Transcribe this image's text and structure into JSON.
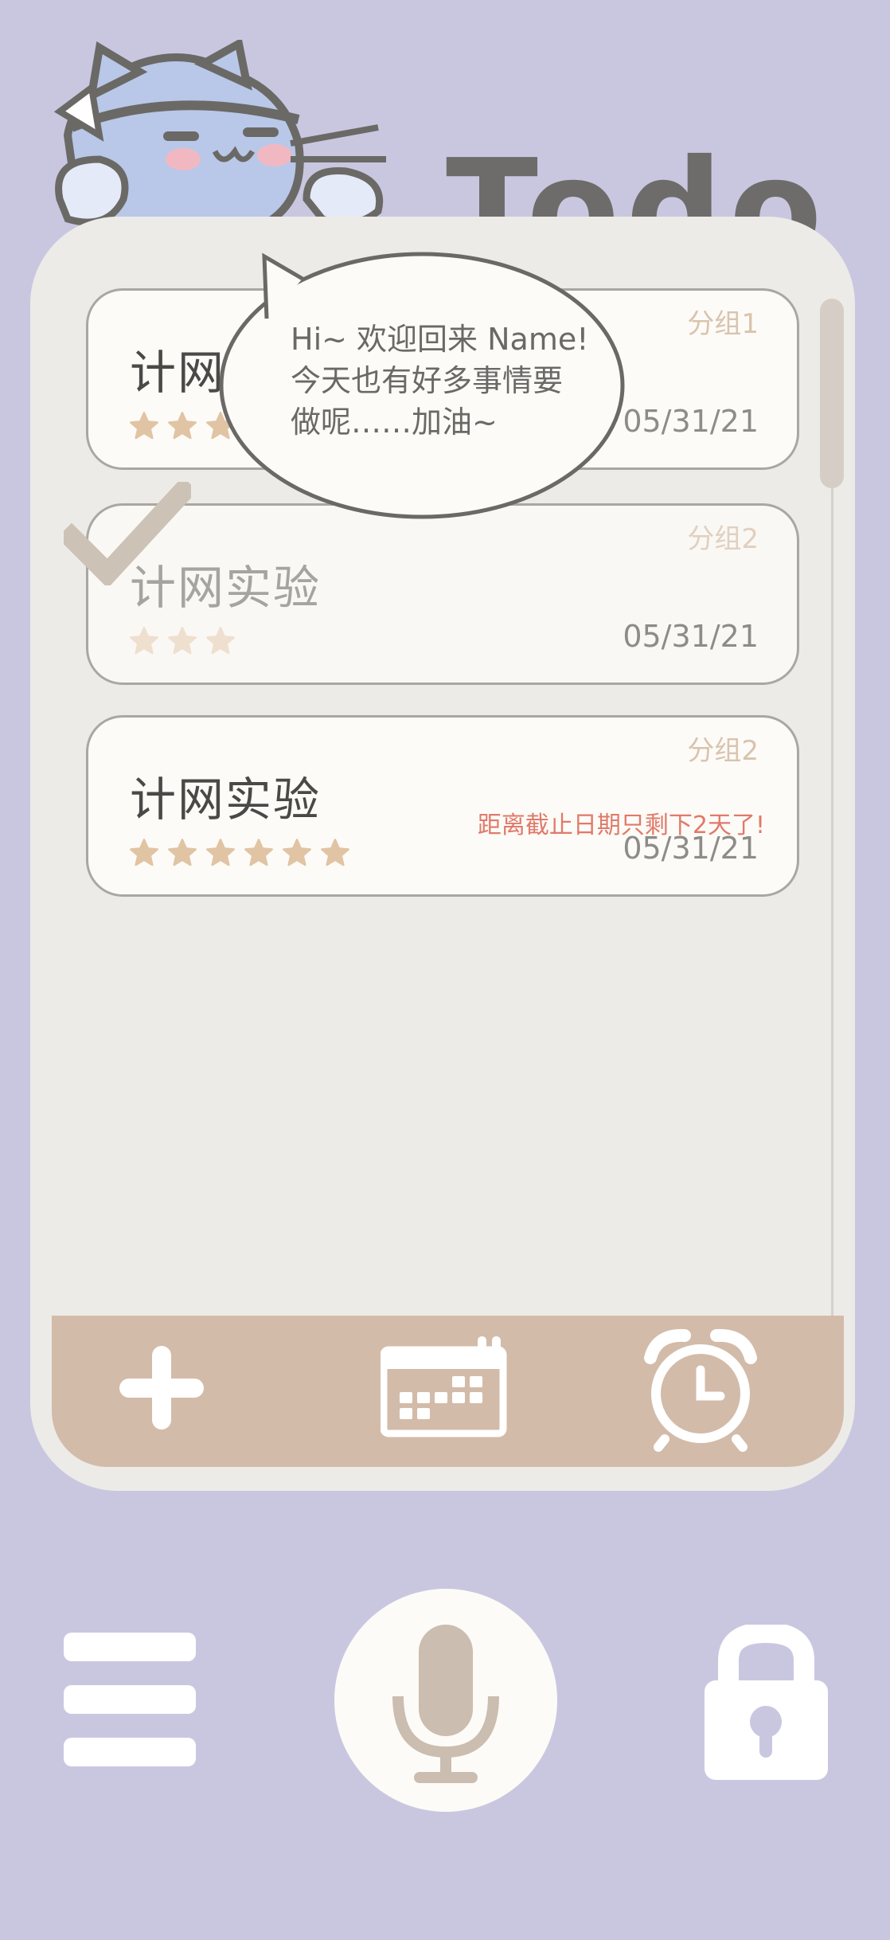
{
  "app": {
    "title": "Todo"
  },
  "bubble": {
    "line1": "Hi~ 欢迎回来 Name!",
    "line2": "今天也有好多事情要",
    "line3": "做呢……加油~"
  },
  "tasks": [
    {
      "title": "计网实验",
      "group": "分组1",
      "date": "05/31/21",
      "stars": 3,
      "completed": false,
      "warning": ""
    },
    {
      "title": "计网实验",
      "group": "分组2",
      "date": "05/31/21",
      "stars": 3,
      "completed": true,
      "warning": ""
    },
    {
      "title": "计网实验",
      "group": "分组2",
      "date": "05/31/21",
      "stars": 6,
      "completed": false,
      "warning": "距离截止日期只剩下2天了!"
    }
  ],
  "toolbar": {
    "add_icon": "plus-icon",
    "calendar_icon": "calendar-icon",
    "alarm_icon": "alarm-clock-icon"
  },
  "nav": {
    "menu_icon": "hamburger-menu-icon",
    "mic_icon": "microphone-icon",
    "lock_icon": "lock-icon"
  },
  "colors": {
    "background": "#c9c7e0",
    "panel": "#ecebe7",
    "card": "#fdfbf7",
    "bottom_bar": "#d3bba9",
    "star": "#e0c4a4",
    "star_done": "#efdfcf",
    "warning": "#e07a6a",
    "logo": "#6e6c6a"
  }
}
